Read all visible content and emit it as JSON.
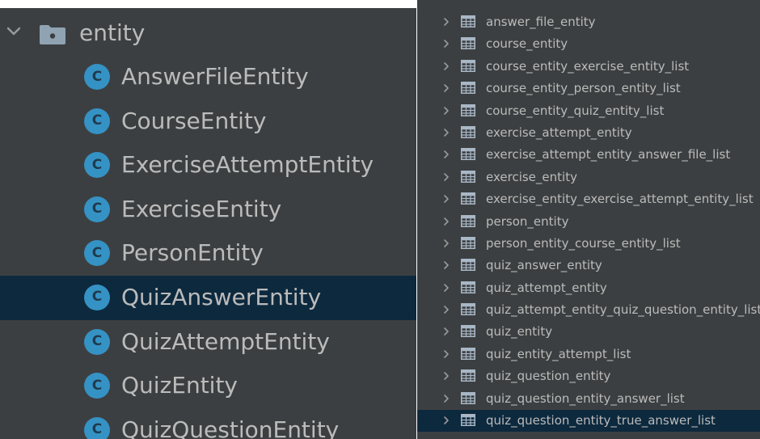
{
  "project_tree": {
    "folder": {
      "label": "entity",
      "icon": "folder-icon",
      "expanded": true
    },
    "classes": [
      {
        "label": "AnswerFileEntity",
        "icon_letter": "C",
        "selected": false
      },
      {
        "label": "CourseEntity",
        "icon_letter": "C",
        "selected": false
      },
      {
        "label": "ExerciseAttemptEntity",
        "icon_letter": "C",
        "selected": false
      },
      {
        "label": "ExerciseEntity",
        "icon_letter": "C",
        "selected": false
      },
      {
        "label": "PersonEntity",
        "icon_letter": "C",
        "selected": false
      },
      {
        "label": "QuizAnswerEntity",
        "icon_letter": "C",
        "selected": true
      },
      {
        "label": "QuizAttemptEntity",
        "icon_letter": "C",
        "selected": false
      },
      {
        "label": "QuizEntity",
        "icon_letter": "C",
        "selected": false
      },
      {
        "label": "QuizQuestionEntity",
        "icon_letter": "C",
        "selected": false
      }
    ]
  },
  "database_tables": {
    "tables": [
      {
        "label": "answer_file_entity",
        "selected": false
      },
      {
        "label": "course_entity",
        "selected": false
      },
      {
        "label": "course_entity_exercise_entity_list",
        "selected": false
      },
      {
        "label": "course_entity_person_entity_list",
        "selected": false
      },
      {
        "label": "course_entity_quiz_entity_list",
        "selected": false
      },
      {
        "label": "exercise_attempt_entity",
        "selected": false
      },
      {
        "label": "exercise_attempt_entity_answer_file_list",
        "selected": false
      },
      {
        "label": "exercise_entity",
        "selected": false
      },
      {
        "label": "exercise_entity_exercise_attempt_entity_list",
        "selected": false
      },
      {
        "label": "person_entity",
        "selected": false
      },
      {
        "label": "person_entity_course_entity_list",
        "selected": false
      },
      {
        "label": "quiz_answer_entity",
        "selected": false
      },
      {
        "label": "quiz_attempt_entity",
        "selected": false
      },
      {
        "label": "quiz_attempt_entity_quiz_question_entity_list",
        "selected": false
      },
      {
        "label": "quiz_entity",
        "selected": false
      },
      {
        "label": "quiz_entity_attempt_list",
        "selected": false
      },
      {
        "label": "quiz_question_entity",
        "selected": false
      },
      {
        "label": "quiz_question_entity_answer_list",
        "selected": false
      },
      {
        "label": "quiz_question_entity_true_answer_list",
        "selected": true
      }
    ]
  },
  "colors": {
    "panel_bg": "#3c3f41",
    "selected_bg": "#0d293e",
    "text": "#bbbbbb",
    "class_icon": "#3592c4",
    "table_icon": "#a9b7c6"
  }
}
